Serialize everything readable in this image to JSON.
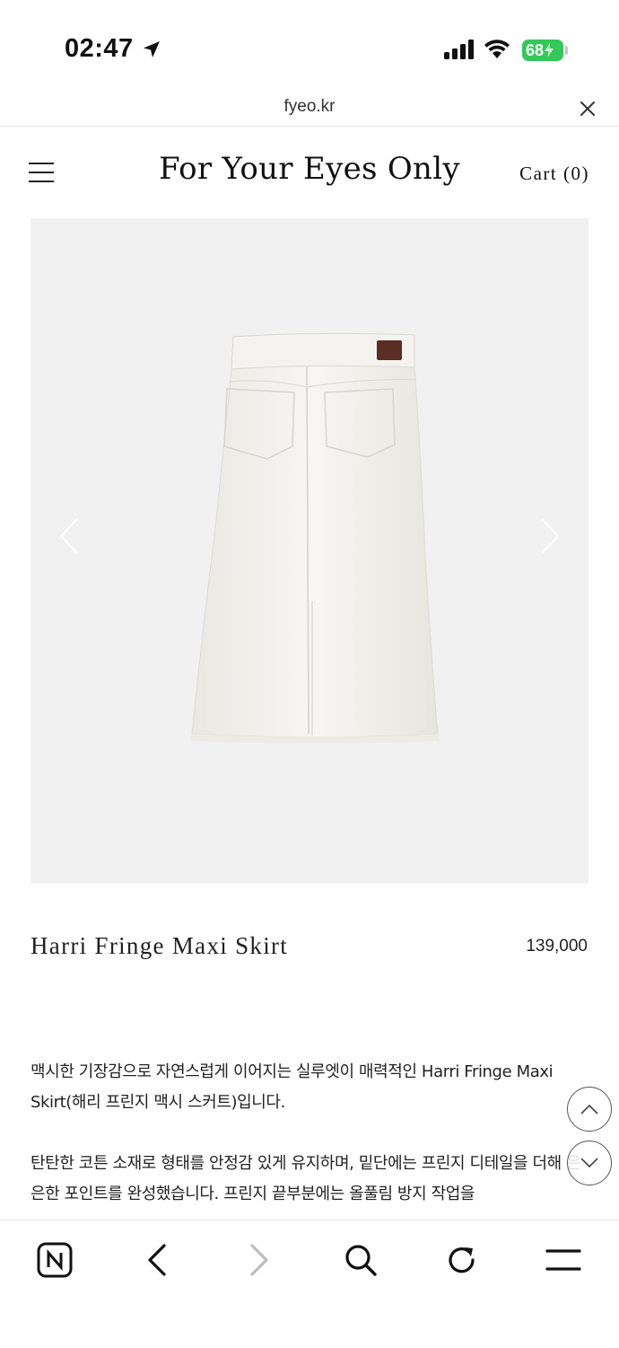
{
  "status_bar": {
    "time": "02:47",
    "battery": "68",
    "icons": [
      "location-arrow-icon",
      "cellular-signal-icon",
      "wifi-icon",
      "battery-charging-icon"
    ]
  },
  "browser": {
    "url": "fyeo.kr",
    "close_icon": "close-icon"
  },
  "header": {
    "menu_icon": "hamburger-menu-icon",
    "site_title": "For Your Eyes Only",
    "cart_label": "Cart (0)"
  },
  "gallery": {
    "image": "white denim maxi skirt, back view",
    "prev_icon": "chevron-left-icon",
    "next_icon": "chevron-right-icon",
    "background": "#f1f1f1"
  },
  "product": {
    "name": "Harri Fringe Maxi Skirt",
    "price": "139,000"
  },
  "description": {
    "paragraph1": "맥시한 기장감으로 자연스럽게 이어지는 실루엣이 매력적인 Harri Fringe Maxi Skirt(해리 프린지 맥시 스커트)입니다.",
    "paragraph2": "탄탄한 코튼 소재로 형태를 안정감 있게 유지하며, 밑단에는 프린지 디테일을 더해 은은한 포인트를 완성했습니다. 프린지 끝부분에는 올풀림 방지 작업을"
  },
  "scroll_controls": {
    "up_icon": "chevron-up-icon",
    "down_icon": "chevron-down-icon"
  },
  "toolbar": {
    "items": [
      "naver-home-icon",
      "back-arrow-icon",
      "forward-arrow-icon",
      "search-icon",
      "reload-icon",
      "menu-icon"
    ]
  }
}
